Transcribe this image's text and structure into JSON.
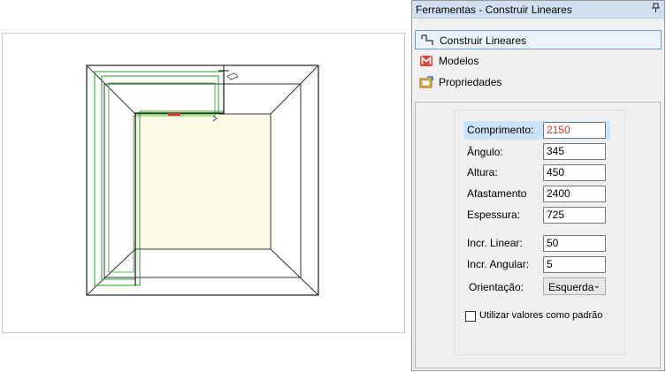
{
  "panel": {
    "title": "Ferramentas - Construir Lineares",
    "pin_glyph": "⭨"
  },
  "nav": {
    "items": [
      {
        "label": "Construir Lineares",
        "icon": "linear-build-icon"
      },
      {
        "label": "Modelos",
        "icon": "models-icon"
      },
      {
        "label": "Propriedades",
        "icon": "properties-icon"
      }
    ]
  },
  "props": {
    "comprimento": {
      "label": "Comprimento:",
      "value": "2150"
    },
    "angulo": {
      "label": "Ângulo:",
      "value": "345"
    },
    "altura": {
      "label": "Altura:",
      "value": "450"
    },
    "afastamento": {
      "label": "Afastamento",
      "value": "2400"
    },
    "espessura": {
      "label": "Espessura:",
      "value": "725"
    },
    "incr_linear": {
      "label": "Incr. Linear:",
      "value": "50"
    },
    "incr_angular": {
      "label": "Incr. Angular:",
      "value": "5"
    },
    "orientacao": {
      "label": "Orientação:",
      "value": "Esquerda"
    },
    "default_checkbox": {
      "label": "Utilizar valores como padrão",
      "checked": false
    }
  },
  "colors": {
    "accent_red": "#d8322f",
    "wall_green": "#27a327",
    "floor_fill": "#fdfde7",
    "selection": "#cce4f7"
  }
}
